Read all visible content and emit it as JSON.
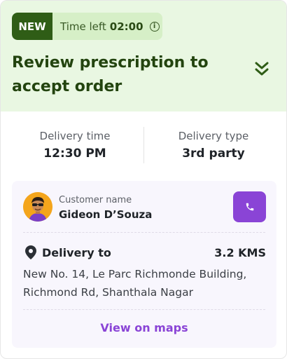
{
  "header": {
    "badge": "NEW",
    "timer_label": "Time left",
    "timer_value": "02:00",
    "title": "Review prescription to accept order"
  },
  "stats": {
    "delivery_time_label": "Delivery time",
    "delivery_time_value": "12:30 PM",
    "delivery_type_label": "Delivery type",
    "delivery_type_value": "3rd party"
  },
  "customer": {
    "label": "Customer name",
    "name": "Gideon D’Souza"
  },
  "delivery": {
    "label": "Delivery to",
    "distance": "3.2 KMS",
    "address": "New No. 14, Le Parc Richmonde Building, Richmond Rd, Shanthala Nagar",
    "maps_link": "View on maps"
  },
  "colors": {
    "header_bg": "#e9f7e2",
    "badge_bg": "#2f5d16",
    "title": "#23440f",
    "accent": "#8a44d6",
    "panel_bg": "#f8f6fd"
  },
  "icons": [
    "info-icon",
    "double-chevron-down-icon",
    "avatar",
    "phone-icon",
    "location-pin-icon"
  ]
}
